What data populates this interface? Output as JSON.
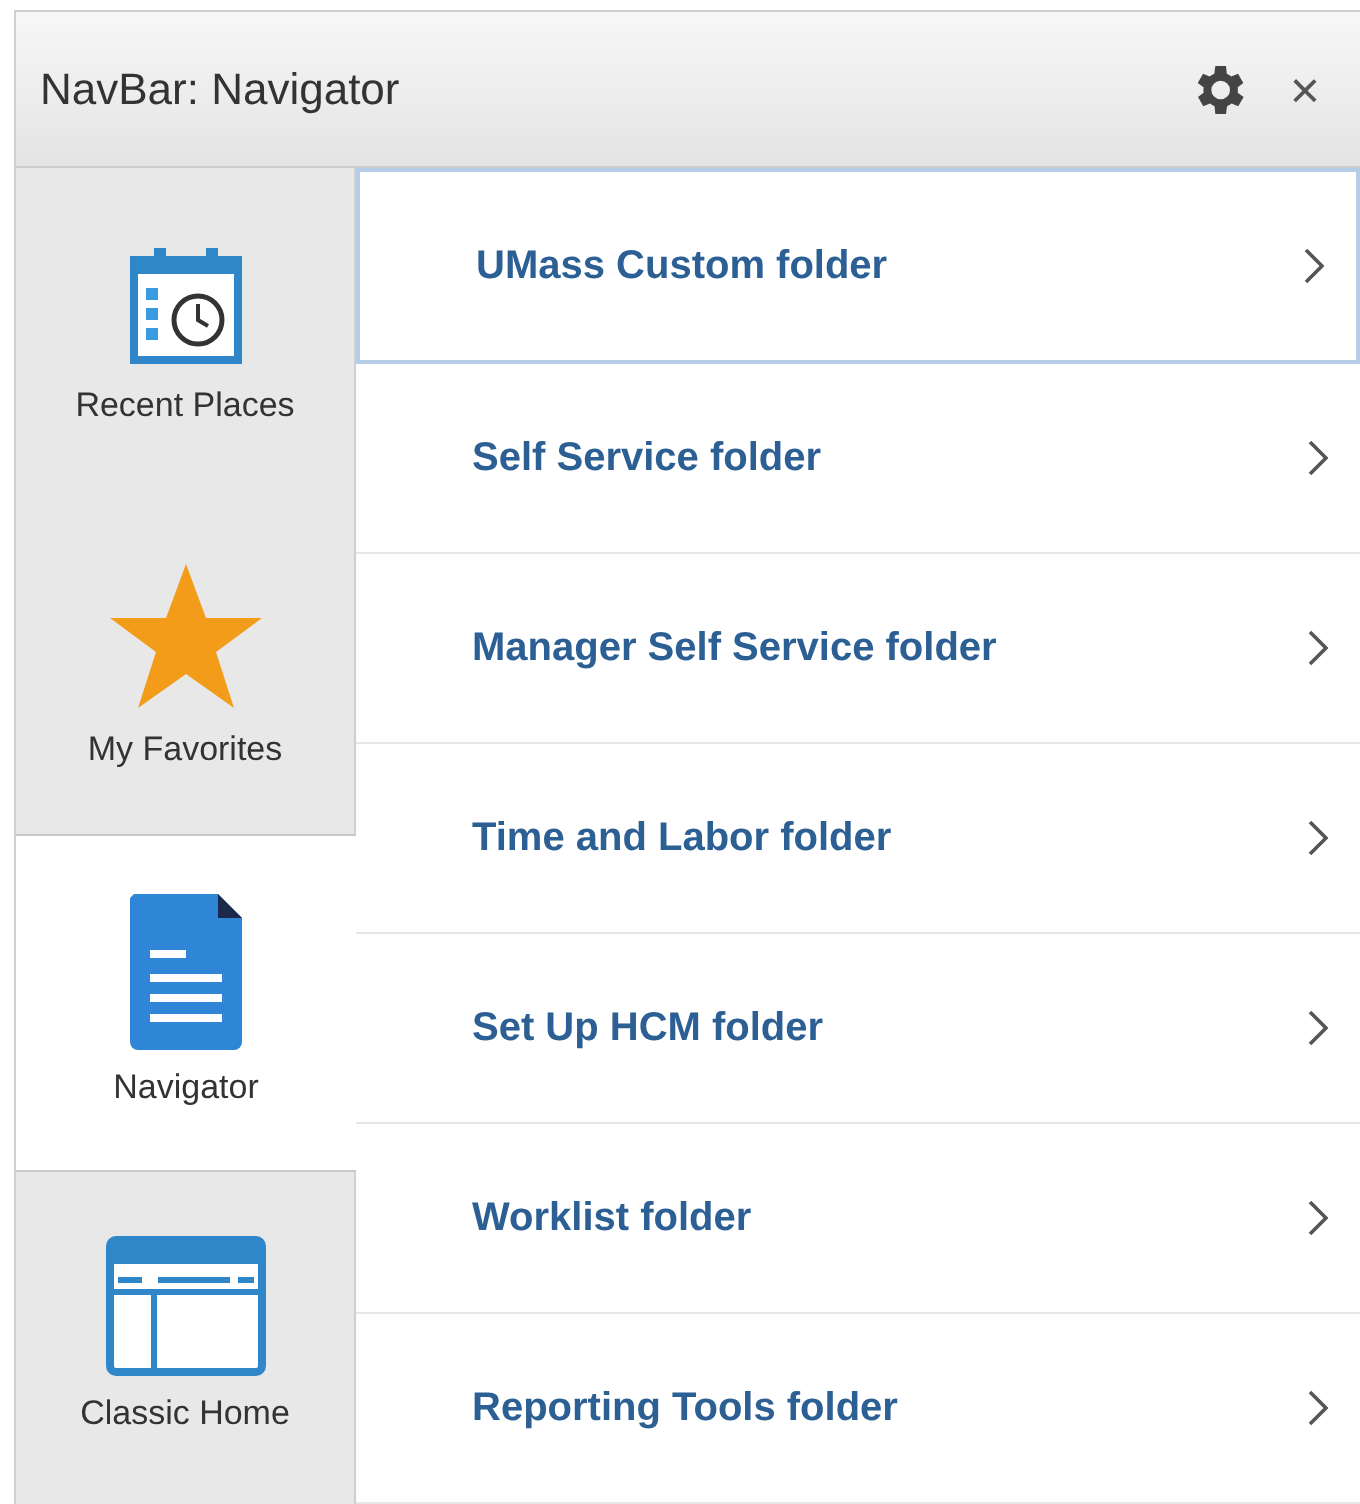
{
  "header": {
    "title": "NavBar: Navigator",
    "close": "×"
  },
  "tabs": [
    {
      "kind": "recent",
      "label": "Recent Places",
      "selected": false
    },
    {
      "kind": "favorites",
      "label": "My Favorites",
      "selected": false
    },
    {
      "kind": "navigator",
      "label": "Navigator",
      "selected": true
    },
    {
      "kind": "classic",
      "label": "Classic Home",
      "selected": false
    }
  ],
  "folders": [
    {
      "label": "UMass Custom folder",
      "selected": true
    },
    {
      "label": "Self Service folder",
      "selected": false
    },
    {
      "label": "Manager Self Service folder",
      "selected": false
    },
    {
      "label": "Time and Labor folder",
      "selected": false
    },
    {
      "label": "Set Up HCM folder",
      "selected": false
    },
    {
      "label": "Worklist folder",
      "selected": false
    },
    {
      "label": "Reporting Tools folder",
      "selected": false
    }
  ]
}
